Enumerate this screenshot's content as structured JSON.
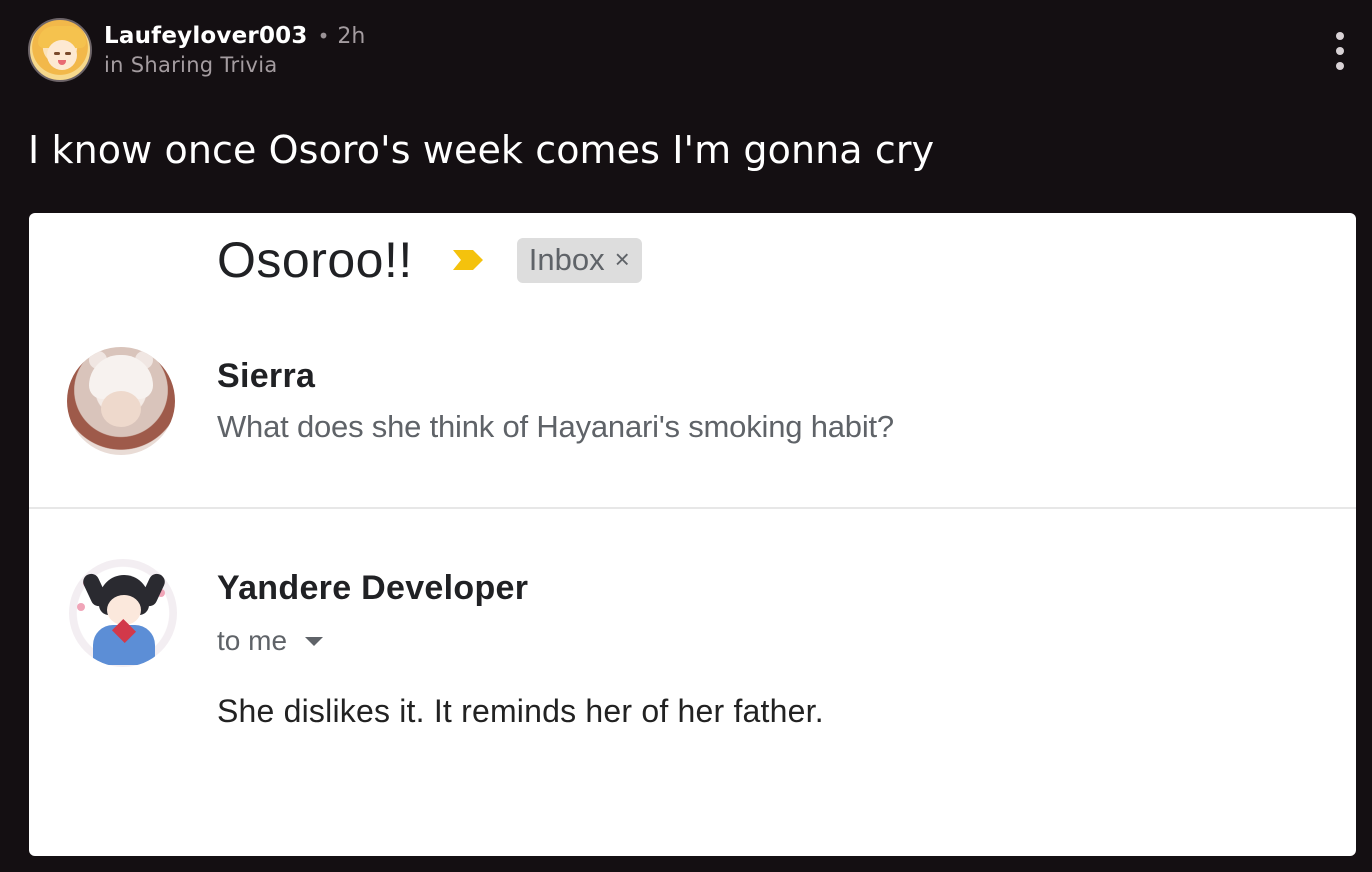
{
  "post": {
    "username": "Laufeylover003",
    "separator": "•",
    "time": "2h",
    "community": "in Sharing Trivia",
    "caption": "I know once Osoro's week comes I'm gonna cry"
  },
  "email": {
    "subject": "Osoroo!!",
    "label_chip": "Inbox",
    "label_chip_close": "×",
    "importance_color": "#f4c20d",
    "messages": [
      {
        "sender": "Sierra",
        "snippet": "What does she think of Hayanari's smoking habit?"
      },
      {
        "sender": "Yandere Developer",
        "recipient": "to me",
        "body": "She dislikes it. It reminds her of her father."
      }
    ]
  },
  "icons": [
    "more-vertical-icon",
    "importance-marker-icon",
    "chevron-down-icon"
  ]
}
